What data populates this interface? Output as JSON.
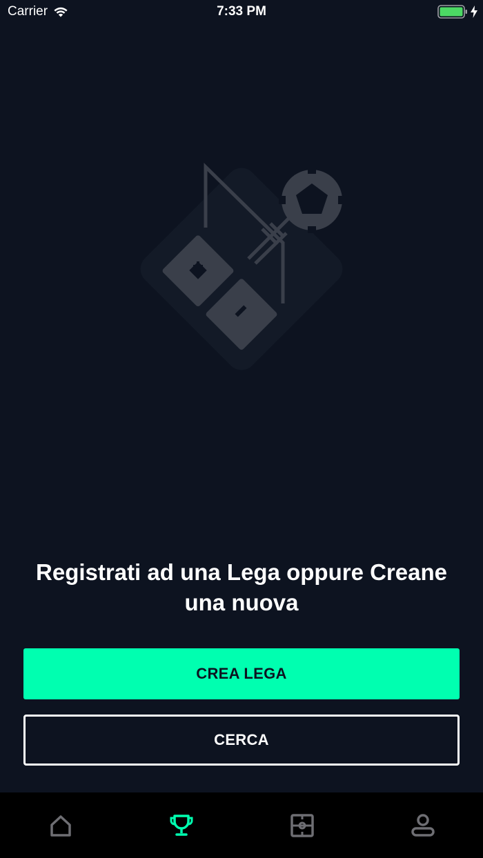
{
  "status_bar": {
    "carrier": "Carrier",
    "time": "7:33 PM",
    "battery_color": "#4cd964"
  },
  "empty_state": {
    "illustration": "football-tactics-board-icon",
    "message": "Registrati ad una Lega oppure Creane una nuova"
  },
  "actions": {
    "create_label": "CREA LEGA",
    "search_label": "CERCA"
  },
  "tab_bar": {
    "items": [
      {
        "icon": "home-icon",
        "active": false
      },
      {
        "icon": "trophy-icon",
        "active": true
      },
      {
        "icon": "football-pitch-icon",
        "active": false
      },
      {
        "icon": "profile-icon",
        "active": false
      }
    ],
    "active_color": "#00ffb0",
    "inactive_color": "#6e6e73"
  },
  "colors": {
    "background": "#0d1320",
    "accent": "#00ffb0"
  }
}
